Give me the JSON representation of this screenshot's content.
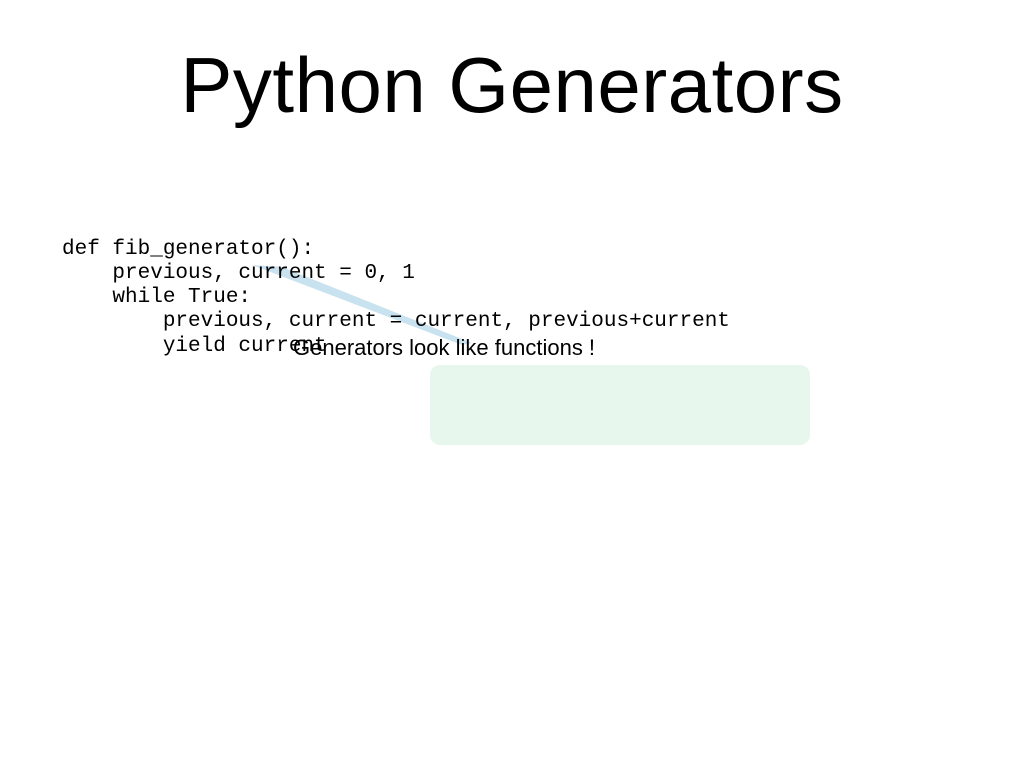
{
  "title": "Python Generators",
  "code": "def fib_generator():\n    previous, current = 0, 1\n    while True:\n        previous, current = current, previous+current\n        yield current",
  "annotation": "Generators look like functions !",
  "colors": {
    "callout_bg": "#e8f7ed",
    "pointer": "#c8e2ef"
  }
}
